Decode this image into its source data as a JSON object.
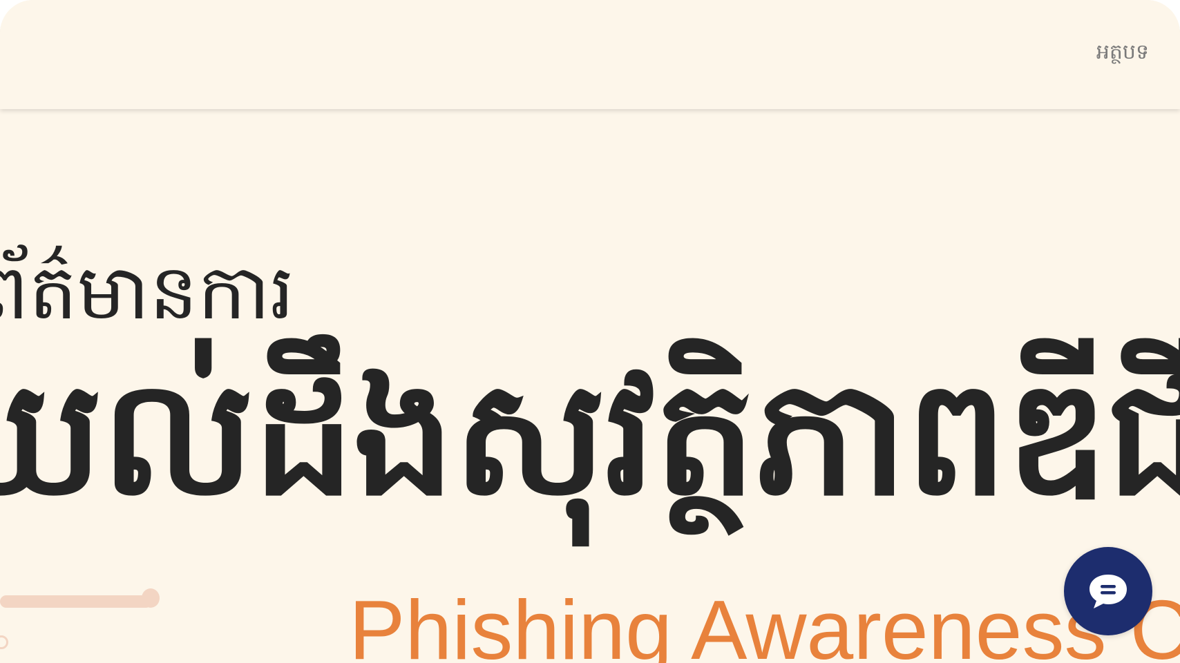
{
  "header": {
    "nav_article": "អត្ថបទ"
  },
  "hero": {
    "line_small": "ព័ត៌មានការ",
    "line_big": "យល់ដឹងសុវត្ថិភាពឌីជីថល",
    "line_english": "Phishing Awareness Campaign"
  },
  "chat": {
    "icon": "chat-bubble-icon"
  },
  "colors": {
    "background": "#fdf6ea",
    "text_dark": "#252525",
    "accent_orange": "#e8823c",
    "chat_navy": "#1d2d6e",
    "decor_peach": "#f3d5c3"
  }
}
